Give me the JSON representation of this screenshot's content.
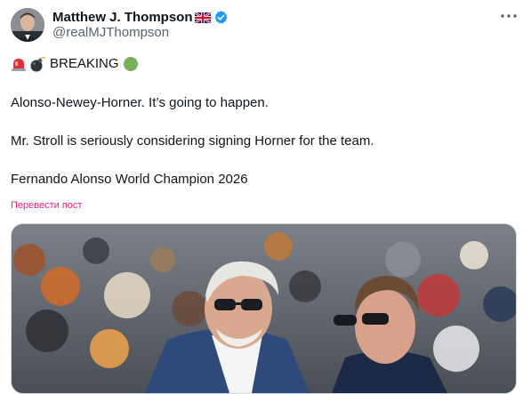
{
  "author": {
    "display_name": "Matthew J. Thompson",
    "handle": "@realMJThompson",
    "flag_icon": "uk-flag-icon",
    "verified_icon": "verified-badge-icon",
    "verified_color": "#1d9bf0"
  },
  "tweet": {
    "breaking_label": "BREAKING",
    "line1": "Alonso-Newey-Horner. It’s going to happen.",
    "line2": "Mr. Stroll is seriously considering signing Horner for the team.",
    "line3": "Fernando Alonso World Champion 2026",
    "translate_label": "Перевести пост",
    "translate_color": "#f9187f"
  },
  "icons": {
    "siren": "siren-emoji-icon",
    "bomb": "bomb-emoji-icon",
    "green_circle": "green-circle-emoji-icon",
    "more": "more-options-icon"
  }
}
